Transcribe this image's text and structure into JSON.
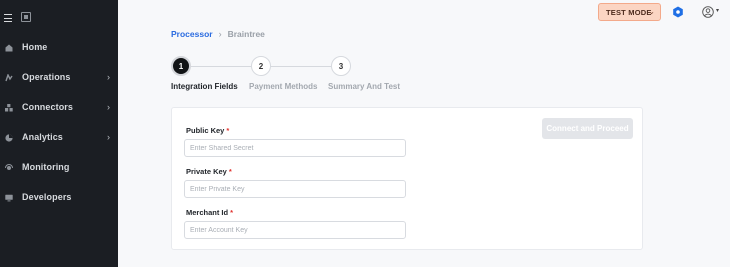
{
  "sidebar": {
    "items": [
      {
        "label": "Home",
        "has_chevron": false
      },
      {
        "label": "Operations",
        "has_chevron": true
      },
      {
        "label": "Connectors",
        "has_chevron": true
      },
      {
        "label": "Analytics",
        "has_chevron": true
      },
      {
        "label": "Monitoring",
        "has_chevron": false
      },
      {
        "label": "Developers",
        "has_chevron": false
      }
    ],
    "chevron": "›"
  },
  "topbar": {
    "mode_label": "TEST MODE",
    "mode_chevron": "⌄",
    "user_caret": "▾"
  },
  "breadcrumb": {
    "parent": "Processor",
    "separator": "›",
    "current": "Braintree"
  },
  "steps": [
    {
      "number": "1",
      "label": "Integration Fields",
      "active": true
    },
    {
      "number": "2",
      "label": "Payment Methods",
      "active": false
    },
    {
      "number": "3",
      "label": "Summary And Test",
      "active": false
    }
  ],
  "form": {
    "required_mark": "*",
    "fields": [
      {
        "label": "Public Key",
        "placeholder": "Enter Shared Secret",
        "value": ""
      },
      {
        "label": "Private Key",
        "placeholder": "Enter Private Key",
        "value": ""
      },
      {
        "label": "Merchant Id",
        "placeholder": "Enter Account Key",
        "value": ""
      }
    ],
    "submit_label": "Connect and Proceed"
  },
  "colors": {
    "sidebar_bg": "#1b1e23",
    "accent_link": "#2a6be0",
    "test_mode_bg": "#fbd5c3",
    "required": "#e0322e",
    "hex_icon": "#1f6fe5"
  }
}
